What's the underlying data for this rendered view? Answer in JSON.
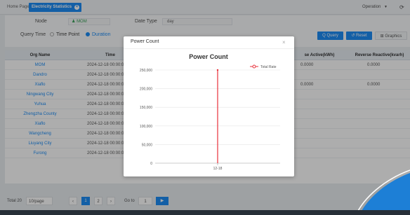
{
  "tabs": {
    "home": "Home Page",
    "active": "Electricity Statistics",
    "close_icon": "close-circle-icon"
  },
  "header": {
    "operation": "Operation",
    "operation_caret": "▼",
    "refresh_icon": "refresh-icon",
    "refresh_glyph": "⟳"
  },
  "filter": {
    "node_label": "Node",
    "node_value": "MOM",
    "date_type_label": "Date Type",
    "date_type_value": "day",
    "query_time_label": "Query Time",
    "options": {
      "time_point": "Time Point",
      "duration": "Duration"
    },
    "query_button": "Q Query",
    "reset_button": "↺ Reset",
    "graphics_button": "⊞ Graphics"
  },
  "table": {
    "headers": {
      "org": "Org Name",
      "time": "Time",
      "fa": "se Active(kWh)",
      "rr": "Reverse Reactive(kvarh)"
    },
    "rows": [
      {
        "org": "MOM",
        "time": "2024-12-18 00:00:00",
        "fa": "0.0000",
        "rr": "0.0000"
      },
      {
        "org": "Dandro",
        "time": "2024-12-18 00:00:00",
        "fa": "",
        "rr": ""
      },
      {
        "org": "Xiaflo",
        "time": "2024-12-18 00:00:00",
        "fa": "0.0000",
        "rr": "0.0000"
      },
      {
        "org": "Ningwang City",
        "time": "2024-12-18 00:00:00",
        "fa": "",
        "rr": ""
      },
      {
        "org": "Yuhua",
        "time": "2024-12-18 00:00:00",
        "fa": "",
        "rr": ""
      },
      {
        "org": "Zhengzha County",
        "time": "2024-12-18 00:00:00",
        "fa": "",
        "rr": ""
      },
      {
        "org": "Xiaflo",
        "time": "2024-12-18 00:00:00",
        "fa": "",
        "rr": ""
      },
      {
        "org": "Wangcheng",
        "time": "2024-12-18 00:00:00",
        "fa": "",
        "rr": ""
      },
      {
        "org": "Liuyang City",
        "time": "2024-12-18 00:00:00",
        "fa": "",
        "rr": ""
      },
      {
        "org": "Furong",
        "time": "2024-12-18 00:00:00",
        "fa": "",
        "rr": ""
      }
    ]
  },
  "pagination": {
    "total": "Total 20",
    "per_page": "10/page",
    "pages": [
      "1",
      "2"
    ],
    "goto_label": "Go to",
    "goto_value": "1",
    "prev": "‹",
    "next": "›",
    "go_button": "▶"
  },
  "modal": {
    "title": "Power Count",
    "close_glyph": "×"
  },
  "chart_data": {
    "type": "line",
    "title": "Power Count",
    "categories": [
      "12-18"
    ],
    "series": [
      {
        "name": "Total Rate",
        "values": [
          250000
        ],
        "color": "#e8303a"
      }
    ],
    "yticks": [
      "0",
      "50,000",
      "100,000",
      "150,000",
      "200,000",
      "250,000"
    ],
    "ylim": [
      0,
      250000
    ],
    "grid": true,
    "legend": "top-right"
  },
  "colors": {
    "accent": "#1c8cf5",
    "series": "#e8303a",
    "corner": "#1d7fd6"
  }
}
